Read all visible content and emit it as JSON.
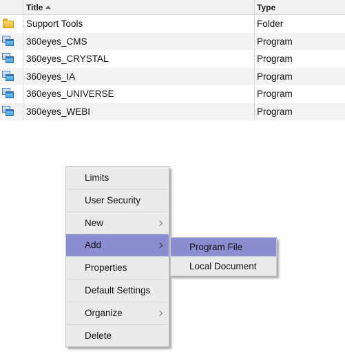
{
  "list": {
    "columns": {
      "title": "Title",
      "type": "Type"
    },
    "rows": [
      {
        "icon": "folder-icon",
        "title": "Support Tools",
        "type": "Folder"
      },
      {
        "icon": "program-icon",
        "title": "360eyes_CMS",
        "type": "Program"
      },
      {
        "icon": "program-icon",
        "title": "360eyes_CRYSTAL",
        "type": "Program"
      },
      {
        "icon": "program-icon",
        "title": "360eyes_IA",
        "type": "Program"
      },
      {
        "icon": "program-icon",
        "title": "360eyes_UNIVERSE",
        "type": "Program"
      },
      {
        "icon": "program-icon",
        "title": "360eyes_WEBI",
        "type": "Program"
      }
    ]
  },
  "context_menu": {
    "items": [
      {
        "label": "Limits",
        "submenu": false
      },
      {
        "label": "User Security",
        "submenu": false
      },
      {
        "label": "New",
        "submenu": true
      },
      {
        "label": "Add",
        "submenu": true,
        "highlighted": true
      },
      {
        "label": "Properties",
        "submenu": false
      },
      {
        "label": "Default Settings",
        "submenu": false
      },
      {
        "label": "Organize",
        "submenu": true
      },
      {
        "label": "Delete",
        "submenu": false
      }
    ],
    "add_submenu": [
      {
        "label": "Program File",
        "highlighted": true
      },
      {
        "label": "Local Document"
      }
    ]
  },
  "colors": {
    "highlight": "#8c8dd0",
    "menu_bg": "#ebebeb",
    "row_alt": "#f3f3f3",
    "header_bg": "#f1f1f1"
  }
}
